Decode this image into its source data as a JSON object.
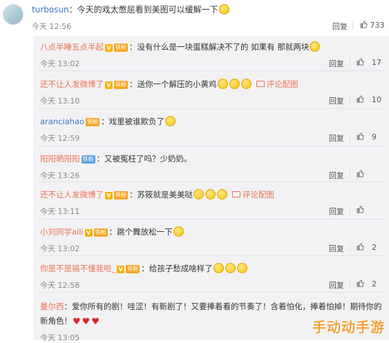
{
  "main_comment": {
    "username": "turbosun",
    "text": "：今天的戏太憋屈看到美图可以缓解一下",
    "time": "今天 12:56",
    "reply_label": "回复",
    "likes": "733"
  },
  "replies": [
    {
      "username": "八点半睡五点半起",
      "badge": "铁粉",
      "text": "：没有什么是一块蛋糕解决不了的 如果有 那就两块",
      "time": "今天 13:02",
      "reply_label": "回复",
      "likes": "17",
      "name_color": "#eb7350"
    },
    {
      "username": "还不让人发微博了",
      "badge": "铁粉",
      "text": "：送你一个解压的小黄鸡",
      "pic_label": "评论配图",
      "time": "今天 13:10",
      "reply_label": "回复",
      "likes": "10",
      "name_color": "#eb7350"
    },
    {
      "username": "aranciahao",
      "badge": "铁粉",
      "text": "：戏里被谁欺负了",
      "time": "今天 12:59",
      "reply_label": "回复",
      "likes": "9",
      "name_color": "#3b78c0"
    },
    {
      "username": "阳阳晒阳阳",
      "badge": "铁粉",
      "text": "：又被冤枉了吗？少奶奶。",
      "time": "今天 13:26",
      "reply_label": "回复",
      "likes": "",
      "name_color": "#eb7350"
    },
    {
      "username": "还不让人发微博了",
      "badge": "铁粉",
      "text": "：苏筱就是美美哒",
      "pic_label": "评论配图",
      "time": "今天 13:11",
      "reply_label": "回复",
      "likes": "",
      "name_color": "#eb7350"
    },
    {
      "username": "小刘同学aili",
      "badge": "铁粉",
      "text": "：跳个舞放松一下",
      "time": "今天 13:02",
      "reply_label": "回复",
      "likes": "2",
      "name_color": "#eb7350"
    },
    {
      "username": "你是不是搞不懂我啦_",
      "badge": "铁粉",
      "text": "：给孩子愁成啥样了",
      "time": "今天 12:58",
      "reply_label": "回复",
      "likes": "2",
      "name_color": "#eb7350"
    },
    {
      "username": "曼尔西",
      "badge": "",
      "text": "：爱你所有的剧！哇涩！有新剧了！又要捧着看的节奏了！含着怕化，捧着怕掉！期待你的新角色！",
      "time": "今天 13:05",
      "reply_label": "",
      "likes": "",
      "name_color": "#eb7350"
    }
  ],
  "watermark": "手动动手游",
  "colors": {
    "orange": "#eb7350",
    "blue": "#3b78c0",
    "sub_bg": "#f2f2f5"
  }
}
